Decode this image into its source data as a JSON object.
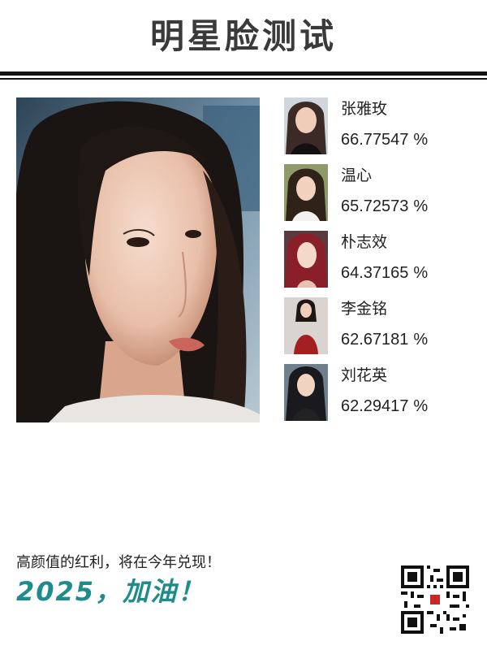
{
  "header": {
    "title": "明星脸测试"
  },
  "main_photo": {
    "icon": "portrait-photo"
  },
  "results": [
    {
      "name": "张雅玫",
      "score": "66.77547",
      "unit": "%",
      "thumb_color": "#3b2a26"
    },
    {
      "name": "温心",
      "score": "65.72573",
      "unit": "%",
      "thumb_color": "#2f2219"
    },
    {
      "name": "朴志效",
      "score": "64.37165",
      "unit": "%",
      "thumb_color": "#8a1f2a"
    },
    {
      "name": "李金铭",
      "score": "62.67181",
      "unit": "%",
      "thumb_color": "#a31f22"
    },
    {
      "name": "刘花英",
      "score": "62.29417",
      "unit": "%",
      "thumb_color": "#1a1a1e"
    }
  ],
  "footer": {
    "slogan": "高颜值的红利，将在今年兑现！",
    "motto": "2025，加油！",
    "motto_color": "#1e8c8a"
  },
  "qr": {
    "icon": "qr-code-icon"
  }
}
